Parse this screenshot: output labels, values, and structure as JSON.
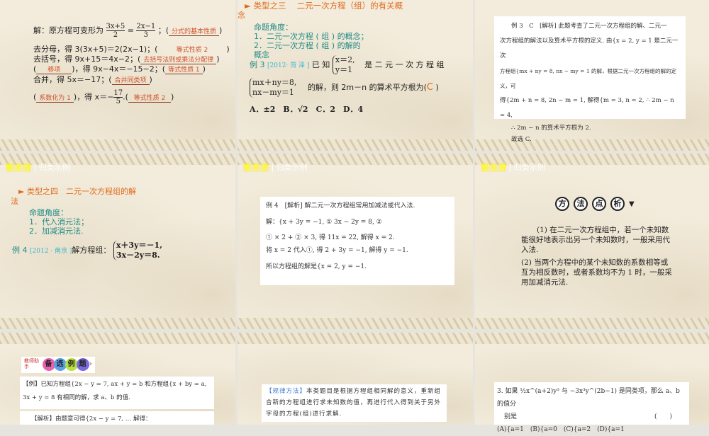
{
  "slide1": {
    "l1": "解：原方程可变形为",
    "l1_f1n": "3x+5",
    "l1_f1d": "2",
    "l1_eq": "=",
    "l1_f2n": "2x−1",
    "l1_f2d": "3",
    "l1_sep": "；",
    "l1_fill": "分式的基本性质",
    "l2": "去分母，得 3(3x+5)＝2(2x−1)；",
    "l2_fill": "等式性质 2",
    "l3": "去括号，得 9x+15＝4x−2；",
    "l3_fill": "去括号法则或乘法分配律",
    "l4_fill": "移项",
    "l4": "，得 9x−4x＝−15−2；",
    "l4_fill2": "等式性质 1",
    "l5": "合并，得 5x＝−17；",
    "l5_fill": "合并同类项",
    "l6_fill": "系数化为 1",
    "l6": "，得 x＝−",
    "l6_fn": "17",
    "l6_fd": "5",
    "l6_end": ".",
    "l6_fill2": "等式性质 2"
  },
  "slide2": {
    "title": "►  类型之三　 二元一次方程（组）的有关概",
    "title2": "念",
    "angle": "命题角度：",
    "items": [
      "1．二元一次方程 ( 组 ) 的概念；",
      "2．二元一次方程 ( 组 ) 的解的",
      "概念"
    ],
    "ex": "例 3",
    "src": "[2012· 菏 泽 ]",
    "known": "已 知",
    "s1": "x＝2,",
    "s2": "y＝1",
    "is": "是 二 元 一 次 方 程 组",
    "s3": "mx＋ny＝8,",
    "s4": "nx－my＝1",
    "q": "的解，则 2m－n 的算术平方根为(",
    "ans": "C",
    "qend": ")",
    "options": "A．±2　B．√2　C．2　D．4"
  },
  "slide3": {
    "lines": [
      "例 3　C　[解析] 此题考查了二元一次方程组的解、二元一",
      "次方程组的解法以及算术平方根的定义. 由{x = 2, y = 1 是二元一次",
      "方程组{mx + ny = 8, nx − my = 1 的解，根据二元一次方程组的解的定义，可",
      "得{2m + n = 8, 2n − m = 1, 解得{m = 3, n = 2, ∴ 2m − n = 4,",
      "∴ 2m − n 的算术平方根为 2.",
      "故选 C."
    ]
  },
  "header": {
    "lecture": "第 6 讲",
    "sep": "|",
    "title": "归类示例"
  },
  "slide4": {
    "title": "►  类型之四　二元一次方程组的解",
    "title2": "法",
    "angle": "命题角度：",
    "items": [
      "1．代入消元法；",
      "2．加减消元法."
    ],
    "ex": "例 4",
    "src": "[2012 · 南京 ]",
    "q": "解方程组：",
    "s1": "x＋3y＝－1,",
    "s2": "3x－2y＝8."
  },
  "slide5": {
    "lines": [
      "例 4　[解析] 解二元一次方程组常用加减法或代入法.",
      "解：{x + 3y = −1, ①  3x − 2y = 8, ②",
      "① × 2 + ② × 3, 得 11x = 22, 解得 x = 2.",
      "将 x = 2 代入①, 得 2 + 3y = −1, 解得 y = −1.",
      "所以方程组的解是{x = 2, y = −1."
    ]
  },
  "slide6": {
    "badges": [
      "方",
      "法",
      "点",
      "析"
    ],
    "p1": "(1) 在二元一次方程组中，若一个未知数能很好地表示出另一个未知数时，一般采用代入法.",
    "p2": "(2) 当两个方程中的某个未知数的系数相等或互为相反数时，或者系数均不为 1 时，一般采用加减消元法."
  },
  "slide7": {
    "tool": "教师助手",
    "balls": [
      "备",
      "选",
      "例",
      "题"
    ],
    "ex": "【例】已知方程组{2x − y = 7, ax + y = b 和方程组{x + by = a, 3x + y = 8 有相同的解，求 a、b 的值.",
    "sol": "【解析】由题意可得{2x − y = 7, … 解得："
  },
  "slide8": {
    "tag": "【规律方法】",
    "text": "本类题目是根据方程组相同解的意义，重新组合新的方程组进行求未知数的值，再进行代入得到关于另外字母的方程(组)进行求解."
  },
  "slide9": {
    "q": "3. 如果 ½x^(a+2)y³ 与 −3x³y^(2b−1) 是同类项，那么 a、b 的值分",
    "q2": "别是",
    "paren": "(　　)",
    "opts": "(A){a=1　(B){a=0　(C){a=2　(D){a=1"
  },
  "colors": {
    "orange": "#e06a1b",
    "teal": "#1f8a86",
    "bg": "#f3ecdc"
  }
}
